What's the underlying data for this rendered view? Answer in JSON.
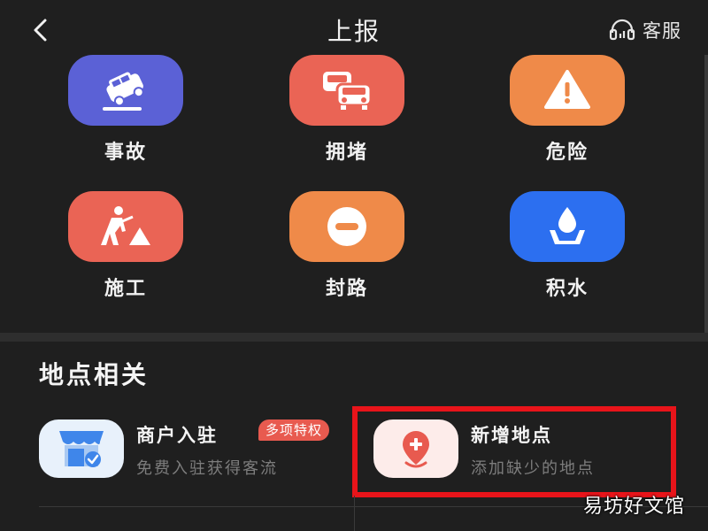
{
  "header": {
    "title": "上报",
    "back_icon": "chevron-left-icon",
    "service_label": "客服",
    "service_icon": "headset-icon"
  },
  "report_items": [
    {
      "label": "事故",
      "icon": "accident-car-icon",
      "color": "#5b61d6"
    },
    {
      "label": "拥堵",
      "icon": "traffic-jam-icon",
      "color": "#ea6455"
    },
    {
      "label": "危险",
      "icon": "warning-icon",
      "color": "#ef8a49"
    },
    {
      "label": "施工",
      "icon": "construction-worker-icon",
      "color": "#ea6455"
    },
    {
      "label": "封路",
      "icon": "road-closed-icon",
      "color": "#ef8a49"
    },
    {
      "label": "积水",
      "icon": "waterlogging-icon",
      "color": "#2c6ff0"
    }
  ],
  "location_section": {
    "title": "地点相关",
    "entries": [
      {
        "title": "商户入驻",
        "subtitle": "免费入驻获得客流",
        "badge": "多项特权",
        "icon": "storefront-icon",
        "icon_bg": "#e8f1fb",
        "icon_color": "#3f86ea"
      },
      {
        "title": "新增地点",
        "subtitle": "添加缺少的地点",
        "icon": "add-location-icon",
        "icon_bg": "#fdecea",
        "icon_color": "#e85a4f"
      }
    ]
  },
  "highlight_color": "#e8141a",
  "watermark": "易坊好文馆"
}
